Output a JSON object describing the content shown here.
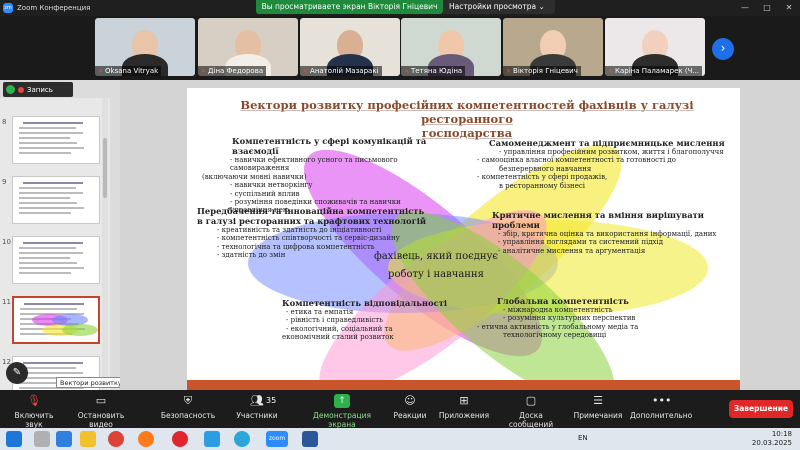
{
  "window": {
    "app_title": "Zoom Конференция",
    "share_banner": "Вы просматриваете экран Вікторія Гніцевич",
    "view_options": "Настройки просмотра",
    "controls": [
      "—",
      "□",
      "✕"
    ]
  },
  "participants": [
    {
      "name": "Oksana Vitryak",
      "muted": true,
      "bg": "#c9d3d9",
      "skin": "#e8c4a8",
      "shirt": "#2a2a2a"
    },
    {
      "name": "Діна Федорова",
      "muted": true,
      "bg": "#d7cfc4",
      "skin": "#e5bfa3",
      "shirt": "#f3efe8"
    },
    {
      "name": "Анатолій Мазаракі",
      "muted": true,
      "bg": "#e6e2da",
      "skin": "#d9b093",
      "shirt": "#23324a"
    },
    {
      "name": "Тетяна Юдіна",
      "muted": true,
      "bg": "#cfd9d2",
      "skin": "#f0c7a8",
      "shirt": "#6a5a7a"
    },
    {
      "name": "Вікторія Гніцевич",
      "muted": true,
      "bg": "#b8a98e",
      "skin": "#f1cdb3",
      "shirt": "#3a3a3a"
    },
    {
      "name": "Каріна Паламарек (Ч...",
      "muted": true,
      "bg": "#ece8ea",
      "skin": "#f1d1bd",
      "shirt": "#2d2d2d"
    }
  ],
  "recording": {
    "label": "Запись"
  },
  "thumbnails": {
    "numbers": [
      "8",
      "9",
      "10",
      "11",
      "12"
    ],
    "active_index": 3,
    "tooltip": "Вектори розвитку професійних ..."
  },
  "slide": {
    "title_line1": "Вектори розвитку професійних компетентностей фахівців у галузі ресторанного",
    "title_line2": "господарства",
    "center_line1": "фахівець, який поєднує",
    "center_line2": "роботу і навчання",
    "blocks": {
      "comm": {
        "heading": "Компетентність у сфері комунікацій та взаємодії",
        "items": [
          "- навички ефективного усного та письмового самовираження",
          "(включаючи мовні навички)",
          "- навички нетворкінгу",
          "- суспільний вплив",
          "- розуміння поведінки споживачів та навички управління нею"
        ]
      },
      "self": {
        "heading": "Самоменеджмент та підприємницьке мислення",
        "items": [
          "- управління професійним розвитком, життя і благополуччя",
          "-     самооцінка власної компетентності та готовності до",
          "безперервного навчання",
          "-     компетентність у сфері продажів,",
          "в ресторанному бізнесі"
        ]
      },
      "innov": {
        "heading": "Передбачення та інноваційна компетентність в галузі ресторанних та крафтових технологій",
        "items": [
          "- креативність та здатність до ініціативності",
          "- компетентність співтворчості та сервіс-дизайну",
          "- технологічна та цифрова компетентність",
          "- здатність до змін"
        ]
      },
      "critical": {
        "heading": "Критичне мислення та вміння вирішувати проблеми",
        "items": [
          "- збір, критична оцінка та використання інформації, даних",
          "- управління поглядами та системний підхід",
          "- аналітичне мислення та аргументація"
        ]
      },
      "resp": {
        "heading": "Компетентність відповідальності",
        "items": [
          "-     етика та емпатія",
          "-     рівність і справедливість",
          "-     екологічний, соціальний та",
          "економічний сталий розвиток"
        ]
      },
      "global": {
        "heading": "Глобальна компетентність",
        "items": [
          "- міжнародна компетентність",
          "- розуміння культурних перспектив",
          "-     етична активність у глобальному медіа та",
          "технологічному середовищі"
        ]
      }
    }
  },
  "toolbar": {
    "mic": "Включить звук",
    "video": "Остановить видео",
    "security": "Безопасность",
    "participants": "Участники",
    "participants_count": "35",
    "share": "Демонстрация экрана",
    "reactions": "Реакции",
    "apps": "Приложения",
    "chat": "Доска сообщений",
    "notes": "Примечания",
    "more": "Дополнительно",
    "end": "Завершение"
  },
  "taskbar": {
    "lang": "EN",
    "time": "10:18",
    "date": "20.03.2025"
  },
  "colors": {
    "zoom_blue": "#2d8cff",
    "share_green": "#1e8a3c",
    "end_red": "#e02828",
    "slide_accent": "#c9552b"
  }
}
